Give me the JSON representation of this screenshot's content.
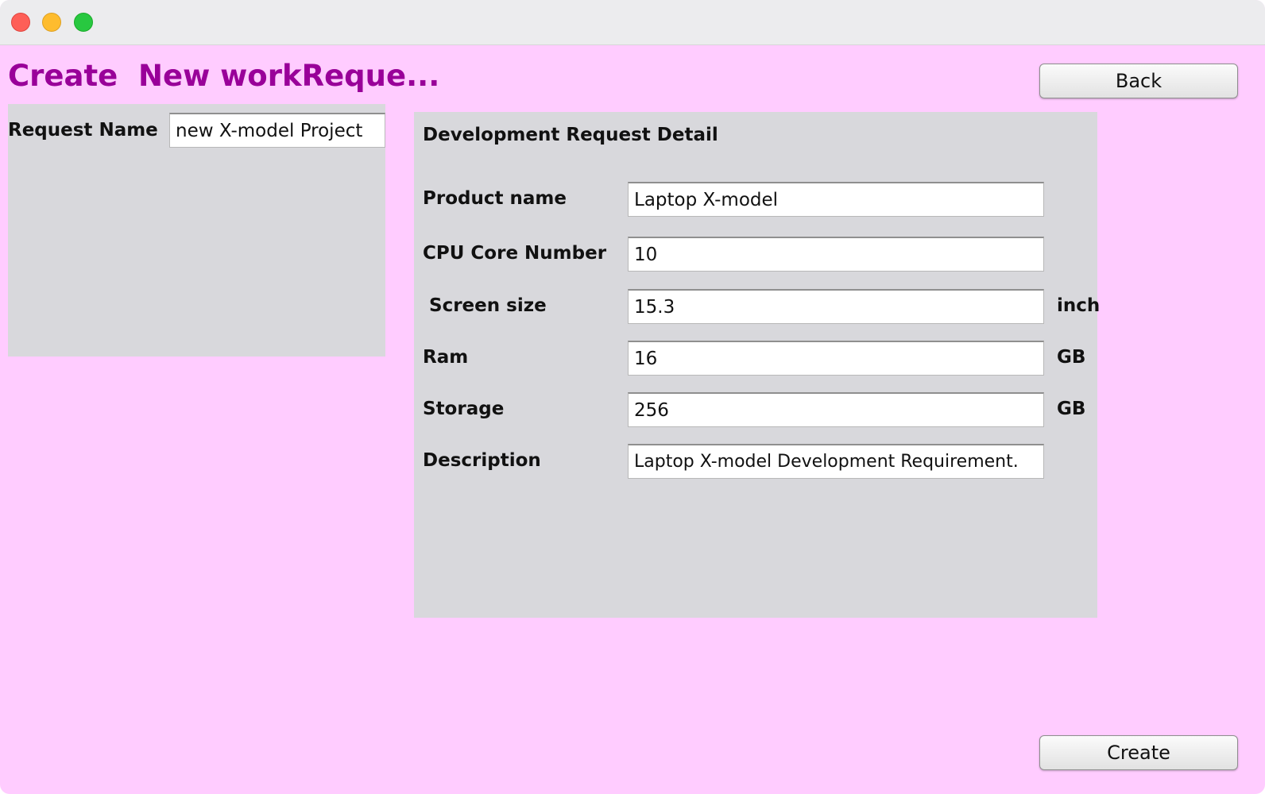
{
  "window": {
    "controls": [
      "close",
      "minimize",
      "maximize"
    ]
  },
  "page": {
    "title": "Create  New workReque..."
  },
  "buttons": {
    "back": "Back",
    "create": "Create"
  },
  "request": {
    "name_label": "Request Name",
    "name_value": "new X-model Project"
  },
  "detail": {
    "section_title": "Development Request Detail",
    "product_name_label": "Product name",
    "product_name_value": "Laptop X-model",
    "cpu_label": "CPU Core Number",
    "cpu_value": "10",
    "screen_label": " Screen size",
    "screen_value": "15.3",
    "screen_unit": "inch",
    "ram_label": "Ram",
    "ram_value": "16",
    "ram_unit": "GB",
    "storage_label": "Storage",
    "storage_value": "256",
    "storage_unit": "GB",
    "description_label": "Description",
    "description_value": "Laptop X-model Development Requirement."
  },
  "colors": {
    "background": "#ffccff",
    "title": "#990099",
    "panel": "#d8d8dc"
  }
}
